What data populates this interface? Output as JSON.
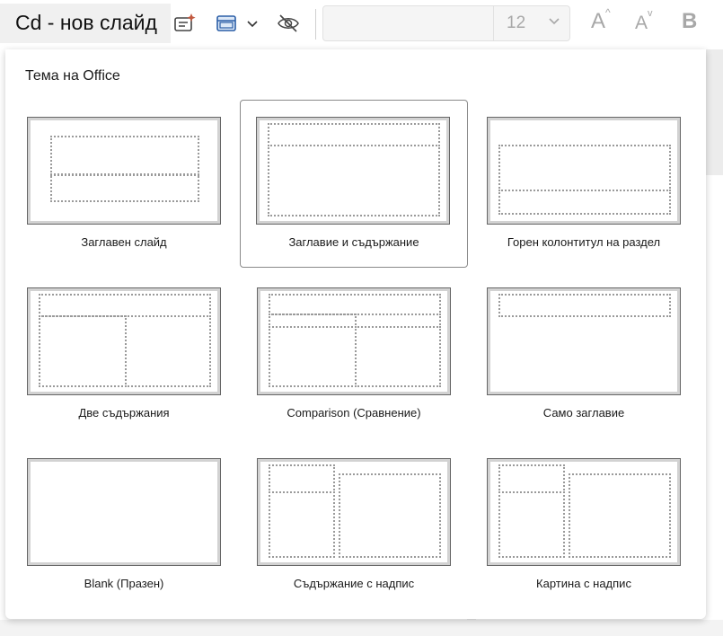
{
  "toolbar": {
    "slide_title": "Cd - нов слайд",
    "font_size": "12",
    "grow_font_label": "A",
    "shrink_font_label": "A",
    "bold_label": "B",
    "icons": [
      "designer-icon",
      "layout-icon",
      "chevron-down-icon",
      "hide-slide-icon",
      "chevron-down-icon"
    ]
  },
  "panel": {
    "header": "Тема на Office",
    "layouts": [
      {
        "label": "Заглавен слайд",
        "selected": false
      },
      {
        "label": "Заглавие и съдържание",
        "selected": true
      },
      {
        "label": "Горен колонтитул на раздел",
        "selected": false
      },
      {
        "label": "Две съдържания",
        "selected": false
      },
      {
        "label": "Comparison (Сравнение)",
        "selected": false
      },
      {
        "label": "Само заглавие",
        "selected": false
      },
      {
        "label": "Blank (Празен)",
        "selected": false
      },
      {
        "label": "Съдържание с надпис",
        "selected": false
      },
      {
        "label": "Картина с надпис",
        "selected": false
      }
    ]
  },
  "colors": {
    "accent_icon": "#c2593f",
    "icon_blue": "#2b5ea7",
    "disabled_text": "#a8a8a8"
  }
}
